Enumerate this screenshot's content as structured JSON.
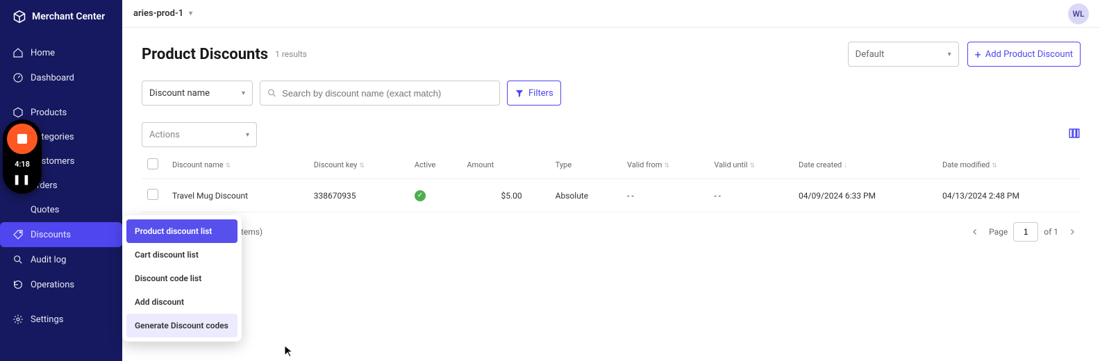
{
  "app_name": "Merchant Center",
  "project": "aries-prod-1",
  "avatar_initials": "WL",
  "sidebar": {
    "items": [
      {
        "label": "Home"
      },
      {
        "label": "Dashboard"
      },
      {
        "label": "Products"
      },
      {
        "label": "Categories"
      },
      {
        "label": "Customers"
      },
      {
        "label": "Orders"
      },
      {
        "label": "Quotes"
      },
      {
        "label": "Discounts"
      },
      {
        "label": "Audit log"
      },
      {
        "label": "Operations"
      },
      {
        "label": "Settings"
      }
    ]
  },
  "page": {
    "title": "Product Discounts",
    "results_count": "1 results",
    "sort_select": "Default",
    "add_button": "Add Product Discount"
  },
  "toolbar": {
    "search_by": "Discount name",
    "search_placeholder": "Search by discount name (exact match)",
    "filters_label": "Filters",
    "actions_label": "Actions"
  },
  "table": {
    "headers": {
      "discount_name": "Discount name",
      "discount_key": "Discount key",
      "active": "Active",
      "amount": "Amount",
      "type": "Type",
      "valid_from": "Valid from",
      "valid_until": "Valid until",
      "date_created": "Date created",
      "date_modified": "Date modified"
    },
    "rows": [
      {
        "discount_name": "Travel Mug Discount",
        "discount_key": "338670935",
        "active": true,
        "amount": "$5.00",
        "type": "Absolute",
        "valid_from": "- -",
        "valid_until": "- -",
        "date_created": "04/09/2024 6:33 PM",
        "date_modified": "04/13/2024 2:48 PM"
      }
    ],
    "items_text": "items)",
    "page_label": "Page",
    "current_page": "1",
    "total_pages": "of 1"
  },
  "flyout": {
    "items": [
      "Product discount list",
      "Cart discount list",
      "Discount code list",
      "Add discount",
      "Generate Discount codes"
    ]
  },
  "recorder": {
    "time": "4:18"
  }
}
